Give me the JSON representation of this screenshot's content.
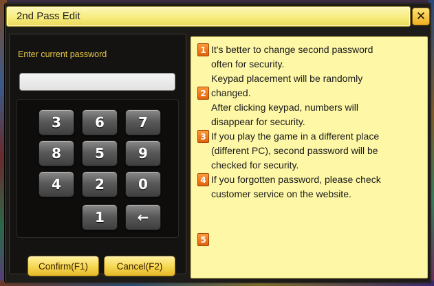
{
  "window": {
    "title": "2nd Pass Edit",
    "close_glyph": "✕"
  },
  "password": {
    "label": "Enter current password",
    "value": ""
  },
  "keypad": {
    "keys": [
      "3",
      "6",
      "7",
      "8",
      "5",
      "9",
      "4",
      "2",
      "0",
      "1",
      "←"
    ]
  },
  "buttons": {
    "confirm": "Confirm(F1)",
    "cancel": "Cancel(F2)"
  },
  "info": {
    "items": [
      {
        "num": "1",
        "lines": [
          "It's better to change second password",
          "often for security."
        ]
      },
      {
        "num": "2",
        "lines": [
          "Keypad placement will be randomly",
          "changed.",
          "After clicking keypad, numbers will",
          "disappear for security."
        ]
      },
      {
        "num": "3",
        "lines": [
          "If you play the game in a different place",
          "(different PC), second password will be",
          "checked for security."
        ]
      },
      {
        "num": "4",
        "lines": [
          "If you forgotten password, please check",
          "customer service on the website."
        ]
      },
      {
        "num": "5",
        "lines": []
      }
    ]
  },
  "colors": {
    "title_bar": "#f7ec7e",
    "info_panel": "#fdf7a6",
    "label_text": "#e8c84a",
    "badge": "#e0620a"
  }
}
